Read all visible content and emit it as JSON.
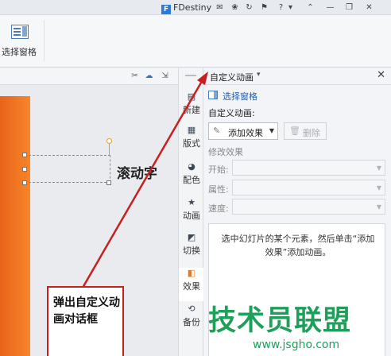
{
  "titlebar": {
    "username": "FDestiny",
    "logo_glyph": "F",
    "help_label": "?",
    "icons": [
      "mail-icon",
      "gift-icon",
      "refresh-icon",
      "pin-icon",
      "minimize-icon",
      "restore-icon",
      "close-icon"
    ]
  },
  "ribbon": {
    "selection_pane_label": "选择窗格"
  },
  "doc_toolbar": {
    "icons": [
      "pin-icon",
      "cloud-icon",
      "export-icon"
    ]
  },
  "slide": {
    "text": "滚动字"
  },
  "tabs": [
    {
      "key": "new",
      "label": "新建",
      "glyph": "▤"
    },
    {
      "key": "layout",
      "label": "版式",
      "glyph": "▦"
    },
    {
      "key": "color",
      "label": "配色",
      "glyph": "◕"
    },
    {
      "key": "animation",
      "label": "动画",
      "glyph": "★"
    },
    {
      "key": "transition",
      "label": "切换",
      "glyph": "◩"
    },
    {
      "key": "effect",
      "label": "效果",
      "glyph": "◧"
    },
    {
      "key": "backup",
      "label": "备份",
      "glyph": "⟲"
    }
  ],
  "pane": {
    "title": "自定义动画",
    "title_caret": "▾",
    "close_glyph": "✕",
    "selection_link": "选择窗格",
    "custom_anim_label": "自定义动画:",
    "add_effect_label": "添加效果",
    "add_caret": "▼",
    "delete_label": "删除",
    "modify_title": "修改效果",
    "fields": [
      {
        "label": "开始:",
        "value": ""
      },
      {
        "label": "属性:",
        "value": ""
      },
      {
        "label": "速度:",
        "value": ""
      }
    ],
    "hint": "选中幻灯片的某个元素，然后单击“添加效果”添加动画。"
  },
  "annotation": {
    "text": "弹出自定义动画对话框",
    "color": "#c82020"
  },
  "watermark": {
    "brand": "技术员联盟",
    "url": "www.jsgho.com",
    "color": "#1fa05a"
  }
}
